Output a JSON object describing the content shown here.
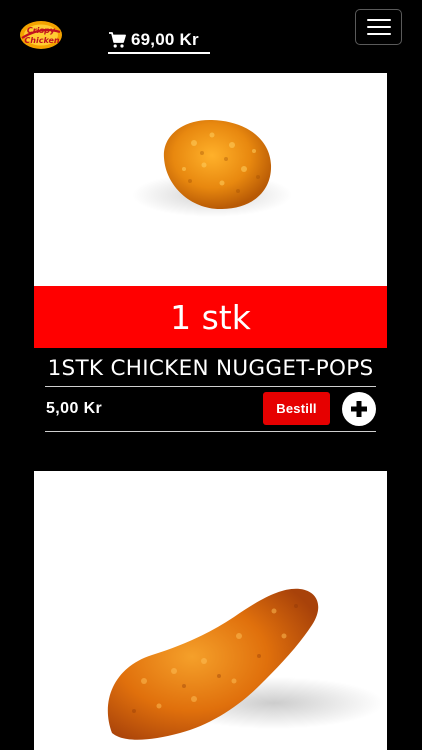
{
  "header": {
    "logo_line1": "Crispy",
    "logo_line2": "Chicken",
    "cart_total": "69,00 Kr"
  },
  "products": [
    {
      "qty_label": "1 stk",
      "title": "1STK CHICKEN NUGGET-POPS",
      "price": "5,00 Kr",
      "order_label": "Bestill"
    },
    {
      "title": "",
      "price": "",
      "order_label": ""
    }
  ],
  "colors": {
    "background": "#000000",
    "accent_red": "#ff0000",
    "order_button": "#e60000",
    "text": "#ffffff"
  }
}
